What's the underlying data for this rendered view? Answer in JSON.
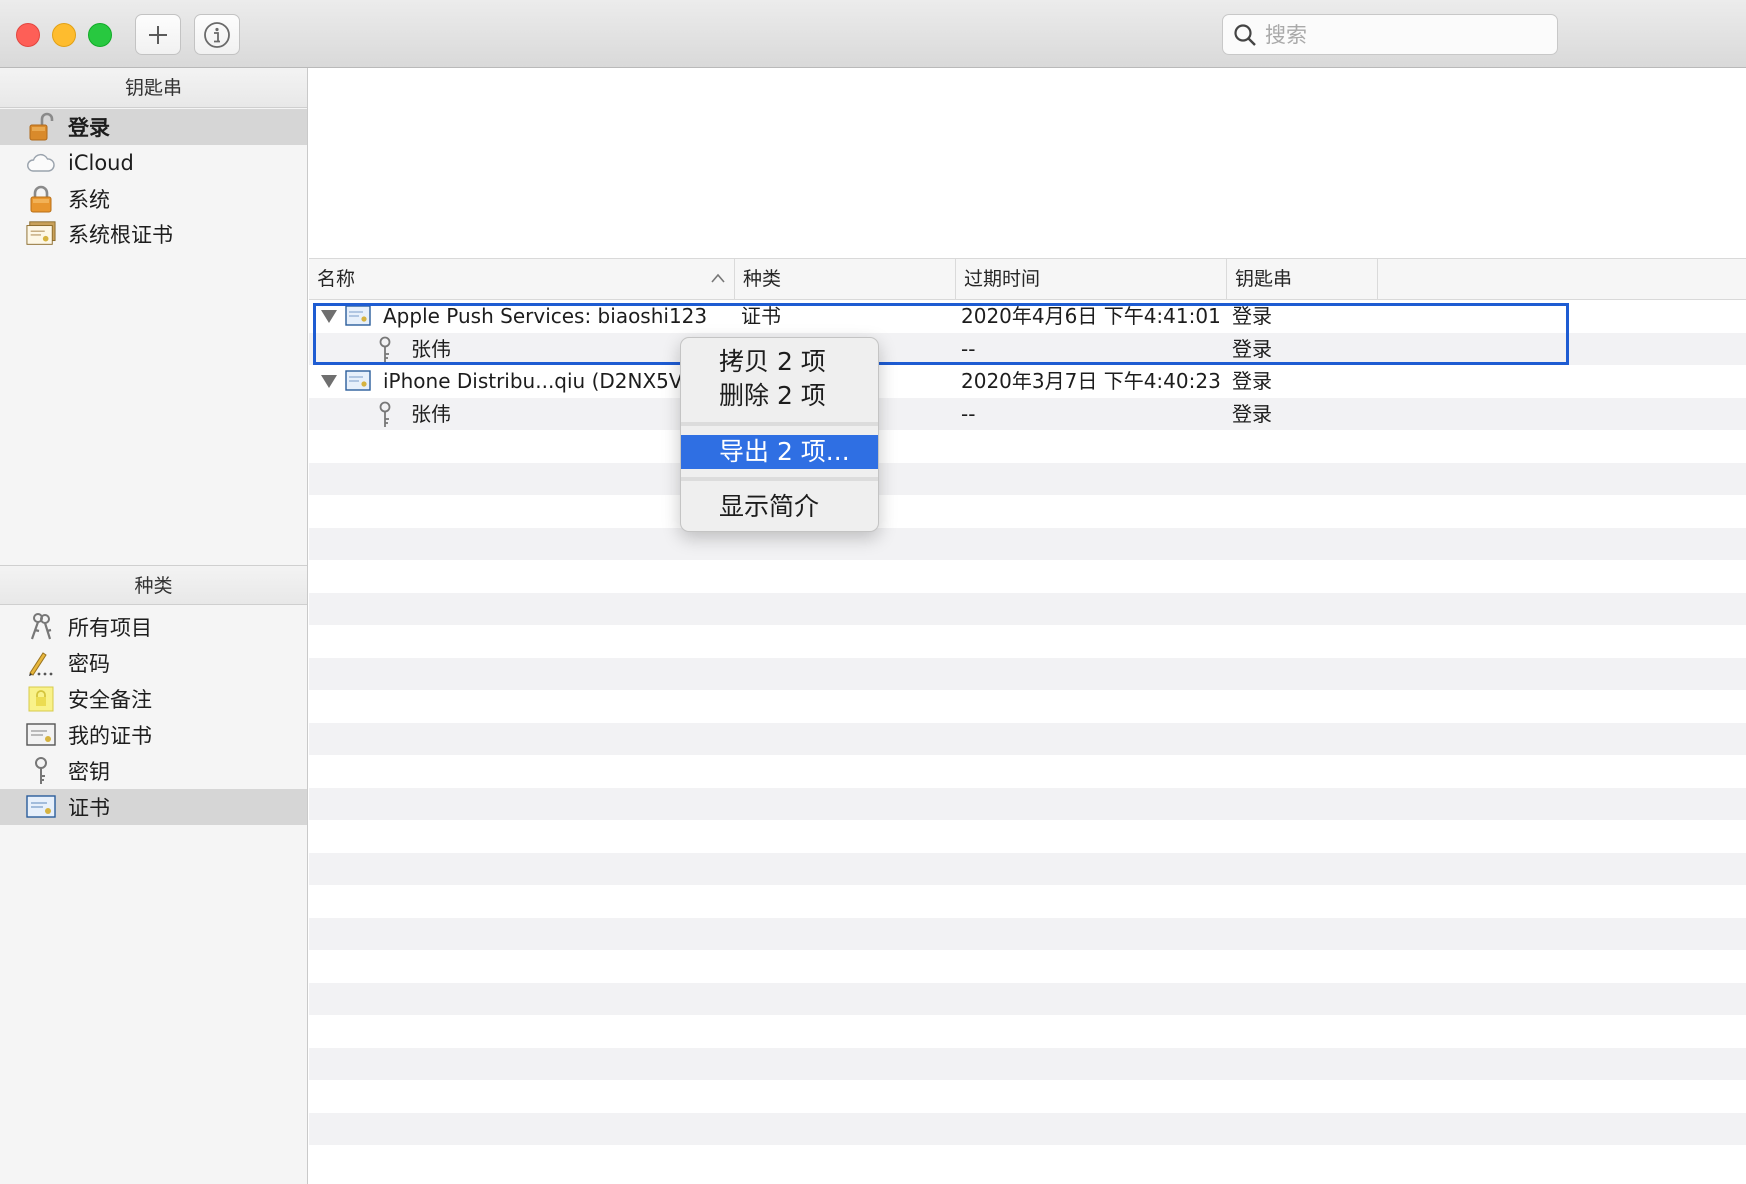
{
  "toolbar": {
    "add_label": "+",
    "info_label": "i",
    "search_placeholder": "搜索"
  },
  "sidebar": {
    "keychains_header": "钥匙串",
    "keychains": [
      {
        "label": "登录",
        "icon": "unlocked-padlock-icon",
        "selected": true
      },
      {
        "label": "iCloud",
        "icon": "cloud-icon"
      },
      {
        "label": "系统",
        "icon": "padlock-icon"
      },
      {
        "label": "系统根证书",
        "icon": "certificates-icon"
      }
    ],
    "category_header": "种类",
    "categories": [
      {
        "label": "所有项目",
        "icon": "keys-icon"
      },
      {
        "label": "密码",
        "icon": "pencil-icon"
      },
      {
        "label": "安全备注",
        "icon": "note-icon"
      },
      {
        "label": "我的证书",
        "icon": "certificate-icon"
      },
      {
        "label": "密钥",
        "icon": "key-icon"
      },
      {
        "label": "证书",
        "icon": "certificate-icon",
        "selected": true
      }
    ]
  },
  "table": {
    "columns": [
      "名称",
      "种类",
      "过期时间",
      "钥匙串"
    ],
    "rows": [
      {
        "name": "Apple Push Services: biaoshi123",
        "kind": "证书",
        "expires": "2020年4月6日 下午4:41:01",
        "keychain": "登录",
        "type": "certificate"
      },
      {
        "name": "张伟",
        "kind": "",
        "expires": "--",
        "keychain": "登录",
        "type": "key"
      },
      {
        "name": "iPhone Distribu...qiu (D2NX5VDR",
        "kind": "",
        "expires": "2020年3月7日 下午4:40:23",
        "keychain": "登录",
        "type": "certificate"
      },
      {
        "name": "张伟",
        "kind": "",
        "expires": "--",
        "keychain": "登录",
        "type": "key"
      }
    ]
  },
  "context_menu": {
    "copy": "拷贝 2 项",
    "delete": "删除 2 项",
    "export": "导出 2 项...",
    "get_info": "显示简介"
  },
  "colors": {
    "selection_border": "#1e5cd2",
    "menu_highlight": "#2f6fe3",
    "close": "#fe5f57",
    "minimize": "#febc2e",
    "zoom": "#28c840"
  }
}
